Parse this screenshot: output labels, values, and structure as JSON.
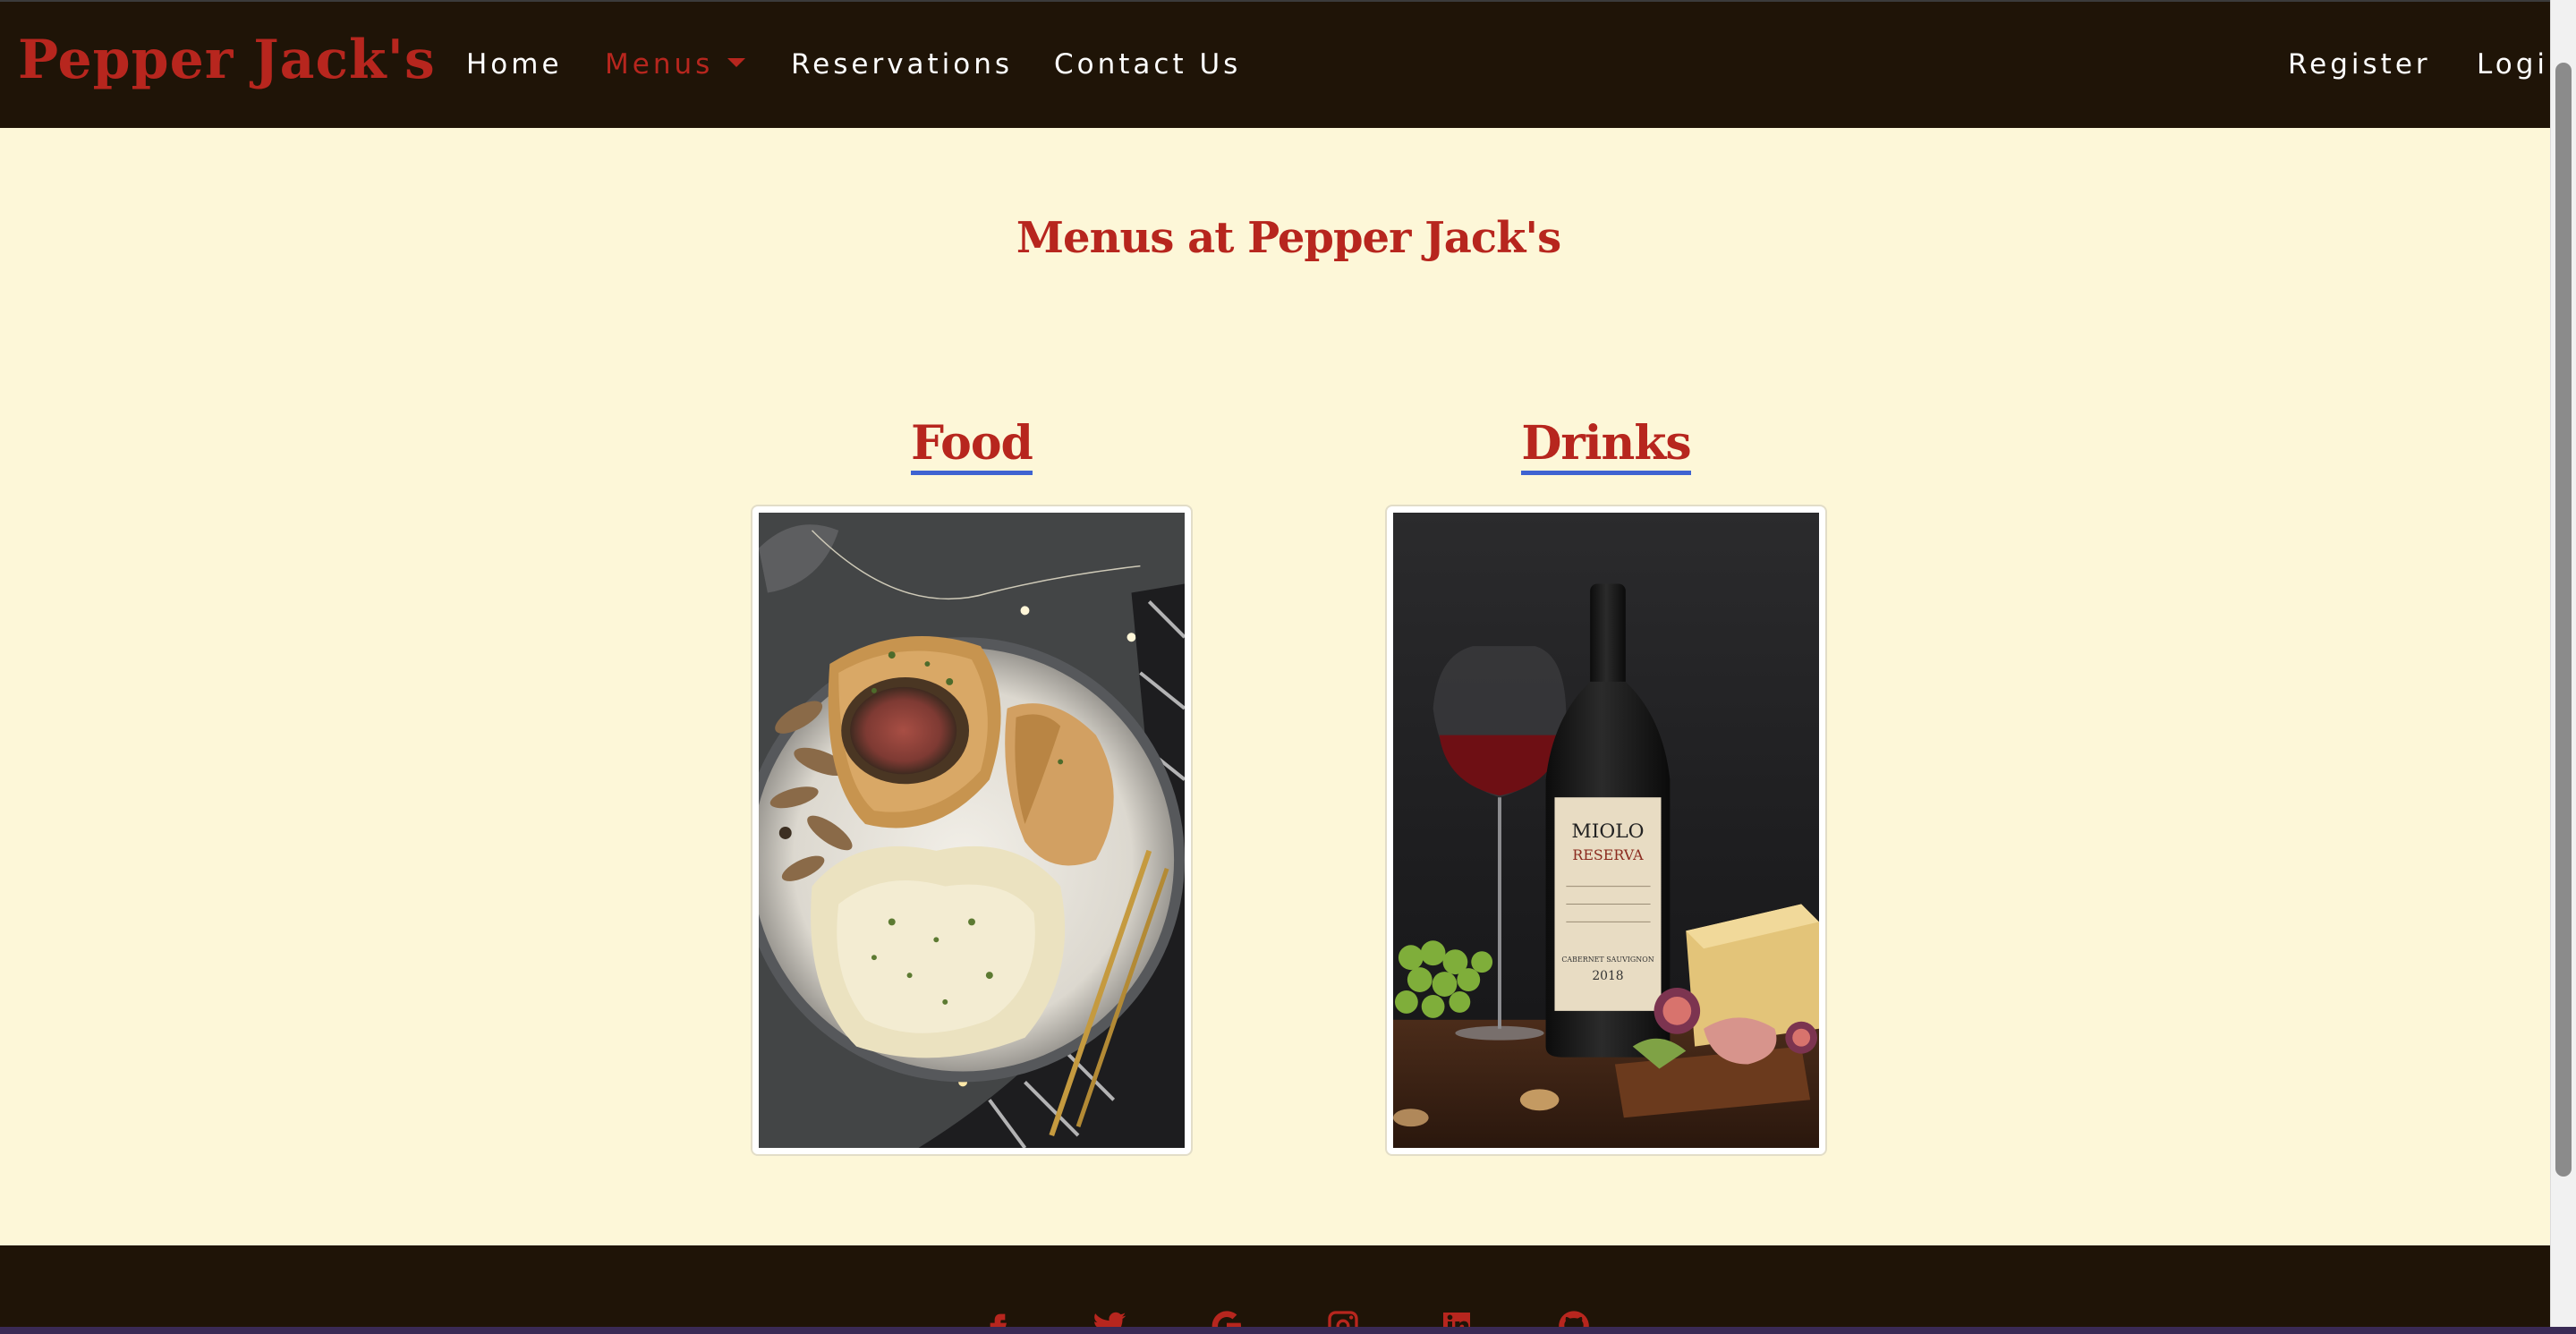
{
  "navbar": {
    "brand": "Pepper Jack's",
    "links": [
      {
        "label": "Home"
      },
      {
        "label": "Menus",
        "active": true,
        "dropdown": true
      },
      {
        "label": "Reservations"
      },
      {
        "label": "Contact Us"
      }
    ],
    "right_links": [
      {
        "label": "Register"
      },
      {
        "label": "Login"
      }
    ]
  },
  "main": {
    "title": "Menus at Pepper Jack's",
    "cards": [
      {
        "heading": "Food"
      },
      {
        "heading": "Drinks"
      }
    ]
  },
  "wine_label": {
    "brand": "MIOLO",
    "line": "RESERVA",
    "varietal": "CABERNET SAUVIGNON",
    "year": "2018"
  },
  "footer": {
    "social_icons": [
      "facebook-icon",
      "twitter-icon",
      "google-icon",
      "instagram-icon",
      "linkedin-icon",
      "github-icon"
    ]
  },
  "colors": {
    "brand_red": "#b7261e",
    "nav_bg": "#1f1407",
    "page_bg": "#fdf7d8",
    "link_underline": "#3f63d1"
  }
}
